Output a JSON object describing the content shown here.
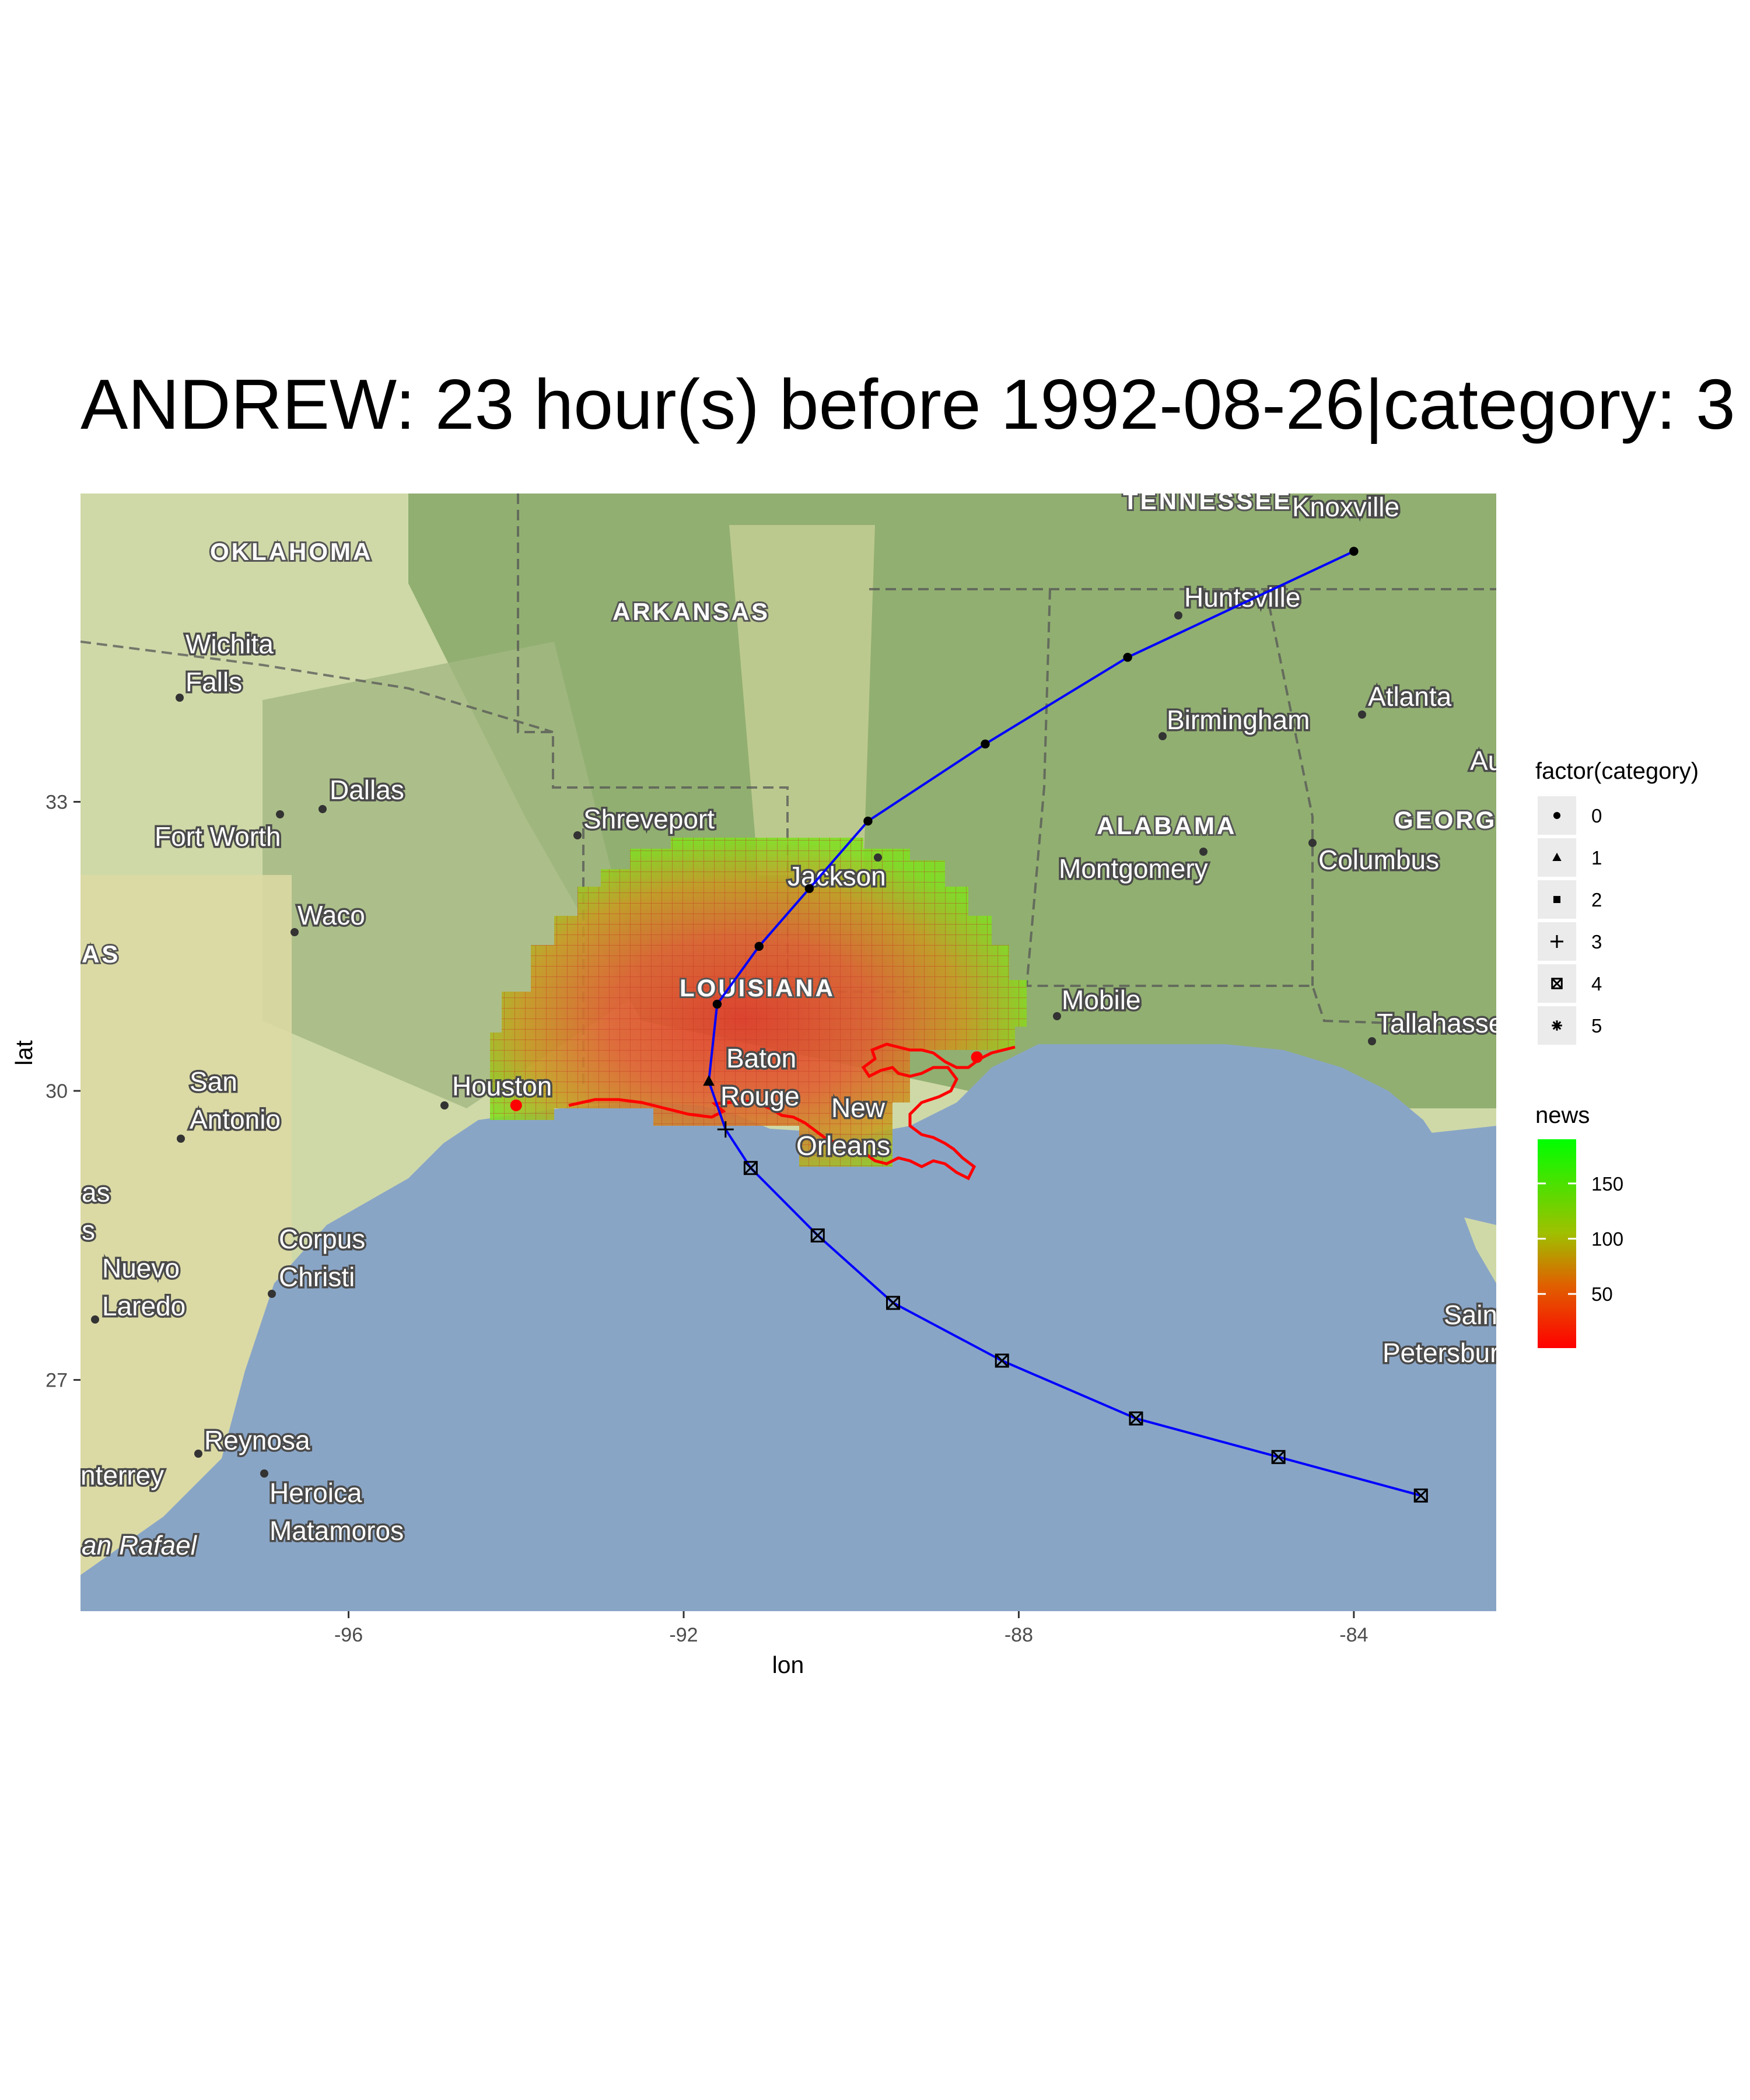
{
  "title": "ANDREW: 23 hour(s) before 1992-08-26|category: 3",
  "chart_data": {
    "type": "map",
    "xlabel": "lon",
    "ylabel": "lat",
    "xlim": [
      -99.2,
      -82.3
    ],
    "ylim": [
      24.6,
      36.2
    ],
    "x_ticks": [
      -96,
      -92,
      -88,
      -84
    ],
    "x_tick_labels": [
      "-96",
      "-92",
      "-88",
      "-84"
    ],
    "y_ticks": [
      27,
      30,
      33
    ],
    "y_tick_labels": [
      "27",
      "30",
      "33"
    ],
    "track_color": "#0000ff",
    "track": [
      {
        "lon": -83.2,
        "lat": 25.8,
        "category": 4
      },
      {
        "lon": -84.9,
        "lat": 26.2,
        "category": 4
      },
      {
        "lon": -86.6,
        "lat": 26.6,
        "category": 4
      },
      {
        "lon": -88.2,
        "lat": 27.2,
        "category": 4
      },
      {
        "lon": -89.5,
        "lat": 27.8,
        "category": 4
      },
      {
        "lon": -90.4,
        "lat": 28.5,
        "category": 4
      },
      {
        "lon": -91.2,
        "lat": 29.2,
        "category": 4
      },
      {
        "lon": -91.5,
        "lat": 29.6,
        "category": 3
      },
      {
        "lon": -91.7,
        "lat": 30.1,
        "category": 1
      },
      {
        "lon": -91.6,
        "lat": 30.9,
        "category": 0
      },
      {
        "lon": -91.1,
        "lat": 31.5,
        "category": 0
      },
      {
        "lon": -90.5,
        "lat": 32.1,
        "category": 0
      },
      {
        "lon": -89.8,
        "lat": 32.8,
        "category": 0
      },
      {
        "lon": -88.4,
        "lat": 33.6,
        "category": 0
      },
      {
        "lon": -86.7,
        "lat": 34.5,
        "category": 0
      },
      {
        "lon": -84.0,
        "lat": 35.6,
        "category": 0
      }
    ],
    "heat_field_color_low": "#ff0000",
    "heat_field_color_high": "#00ff00",
    "coastline_color": "#ff0000",
    "endpoint_markers": [
      {
        "lon": -94.0,
        "lat": 29.85
      },
      {
        "lon": -88.5,
        "lat": 30.35
      }
    ],
    "legend_category": {
      "title": "factor(category)",
      "entries": [
        {
          "label": "0",
          "shape": "circle"
        },
        {
          "label": "1",
          "shape": "triangle"
        },
        {
          "label": "2",
          "shape": "square"
        },
        {
          "label": "3",
          "shape": "plus"
        },
        {
          "label": "4",
          "shape": "boxed-x"
        },
        {
          "label": "5",
          "shape": "asterisk"
        }
      ]
    },
    "legend_news": {
      "title": "news",
      "labels": [
        "150",
        "100",
        "50"
      ],
      "breaks": [
        150,
        100,
        50
      ],
      "range": [
        1,
        190
      ],
      "colors": [
        "#00ff00",
        "#ff0000"
      ]
    }
  },
  "map_labels": {
    "states": [
      "OKLAHOMA",
      "ARKANSAS",
      "LOUISIANA",
      "ALABAMA",
      "TENNESSEE",
      "GEORGI",
      "AS"
    ],
    "cities": [
      "Wichita",
      "Falls",
      "Dallas",
      "Fort Worth",
      "Waco",
      "Shreveport",
      "Jackson",
      "Huntsville",
      "Birmingham",
      "Atlanta",
      "Montgomery",
      "Columbus",
      "Mobile",
      "Tallahassee",
      "Houston",
      "San",
      "Antonio",
      "Baton",
      "Rouge",
      "New",
      "Orleans",
      "Corpus",
      "Christi",
      "Nuevo",
      "Laredo",
      "Reynosa",
      "nterrey",
      "Heroica",
      "Matamoros",
      "Saint",
      "Petersburg",
      "Knoxville",
      "Au",
      "as",
      "s",
      "an Rafael"
    ]
  }
}
